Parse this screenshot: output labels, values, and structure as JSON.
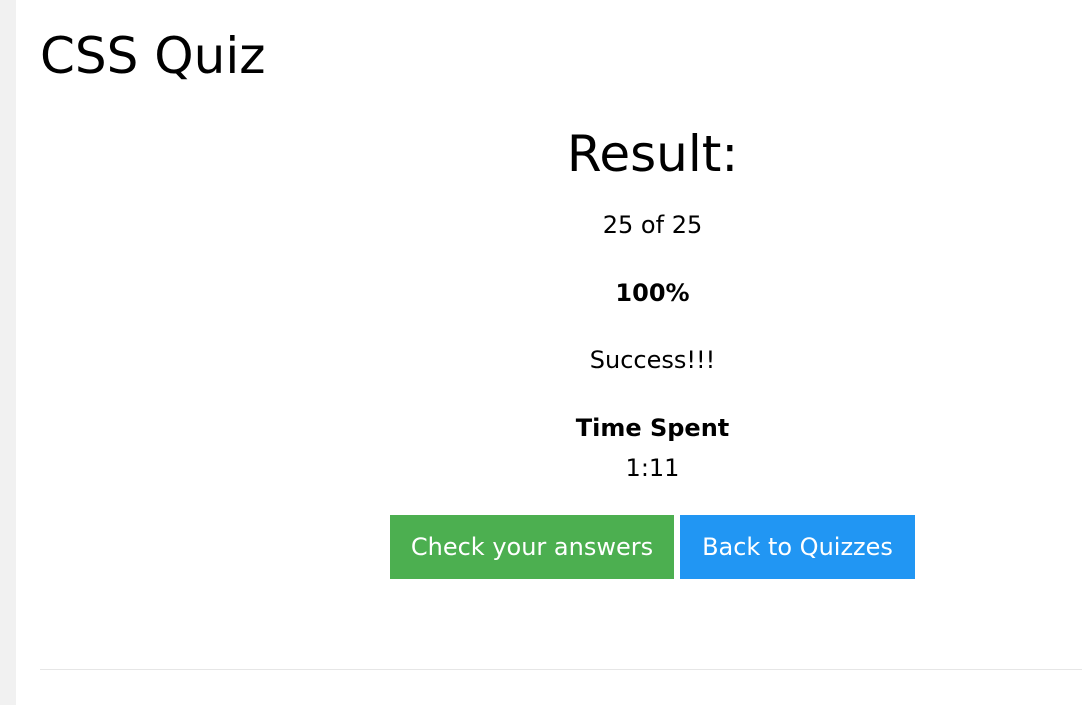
{
  "page": {
    "title": "CSS Quiz"
  },
  "result": {
    "heading": "Result:",
    "score_text": "25 of 25",
    "percent_text": "100%",
    "verdict": "Success!!!",
    "time_label": "Time Spent",
    "time_value": "1:11",
    "score_fraction": 1.0
  },
  "actions": {
    "check_answers_label": "Check your answers",
    "back_label": "Back to Quizzes"
  },
  "colors": {
    "check_button": "#4caf50",
    "back_button": "#2196f3",
    "left_rail": "#f1f1f1",
    "divider": "#e6e6e6"
  }
}
